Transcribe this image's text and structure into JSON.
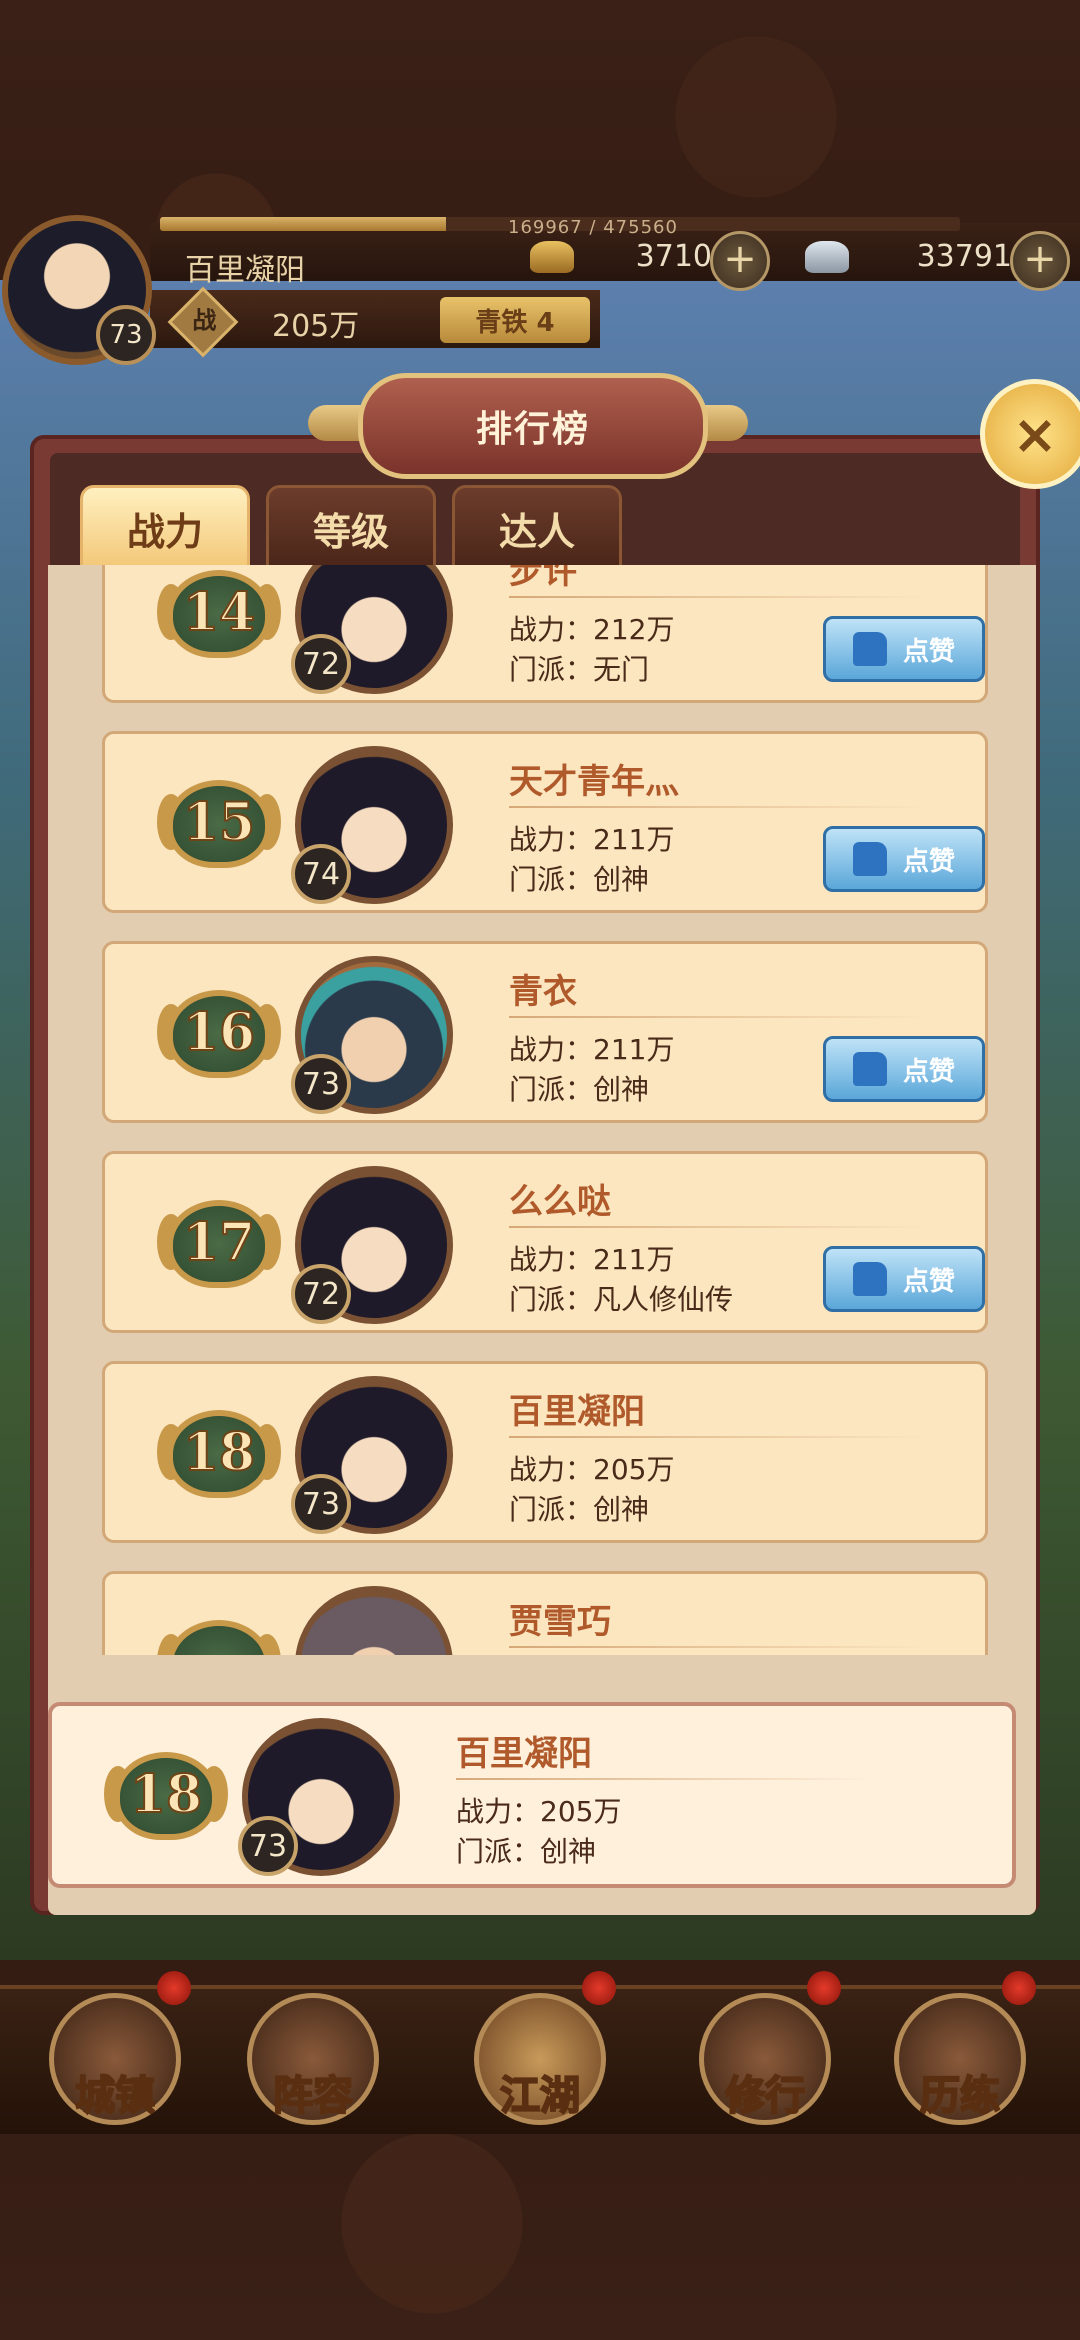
{
  "player": {
    "name": "百里凝阳",
    "level": "73",
    "exp_text": "169967 / 475560",
    "exp_fraction": 0.357,
    "power_icon_label": "战",
    "power": "205万",
    "rank_badge": "青铁 4",
    "silver": "3710",
    "gold": "33791"
  },
  "panel": {
    "title": "排行榜",
    "close_icon": "×",
    "tabs": [
      {
        "label": "战力",
        "active": true
      },
      {
        "label": "等级",
        "active": false
      },
      {
        "label": "达人",
        "active": false
      }
    ]
  },
  "rows": [
    {
      "rank": "14",
      "level": "72",
      "name": "步许",
      "power_line": "战力：212万",
      "sect_line": "门派：无门",
      "like": "点赞",
      "portrait": "default"
    },
    {
      "rank": "15",
      "level": "74",
      "name": "天才青年灬",
      "power_line": "战力：211万",
      "sect_line": "门派：创神",
      "like": "点赞",
      "portrait": "default"
    },
    {
      "rank": "16",
      "level": "73",
      "name": "青衣",
      "power_line": "战力：211万",
      "sect_line": "门派：创神",
      "like": "点赞",
      "portrait": "alt"
    },
    {
      "rank": "17",
      "level": "72",
      "name": "么么哒",
      "power_line": "战力：211万",
      "sect_line": "门派：凡人修仙传",
      "like": "点赞",
      "portrait": "default"
    },
    {
      "rank": "18",
      "level": "73",
      "name": "百里凝阳",
      "power_line": "战力：205万",
      "sect_line": "门派：创神",
      "like": "",
      "portrait": "default"
    },
    {
      "rank": "",
      "level": "",
      "name": "贾雪巧",
      "power_line": "",
      "sect_line": "",
      "like": "",
      "portrait": "alt2"
    }
  ],
  "self": {
    "rank": "18",
    "level": "73",
    "name": "百里凝阳",
    "power_line": "战力：205万",
    "sect_line": "门派：创神"
  },
  "nav": [
    {
      "label": "城镇"
    },
    {
      "label": "阵容"
    },
    {
      "label": "江湖"
    },
    {
      "label": "修行"
    },
    {
      "label": "历练"
    }
  ],
  "colors": {
    "accent_gold": "#e3c27e",
    "panel_red": "#7a3a34",
    "row_bg": "#fbe6c0",
    "like_blue": "#5aa7d9"
  },
  "icons": {
    "silver": "silver-ingot-icon",
    "gold": "gold-ingot-icon",
    "plus": "plus-icon",
    "thumb": "thumbs-up-icon"
  }
}
